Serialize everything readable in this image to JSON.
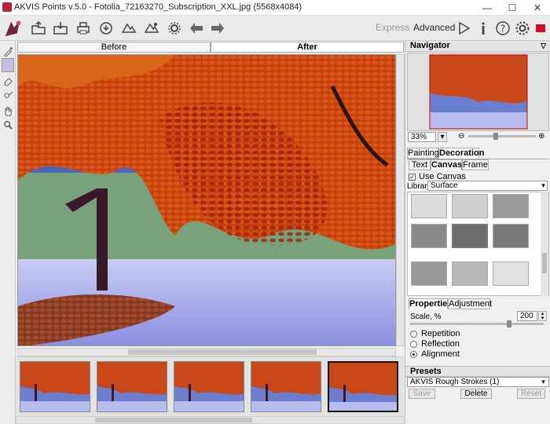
{
  "window": {
    "title": "AKVIS Points v.5.0 - Fotolia_72163270_Subscription_XXL.jpg (5568x4084)",
    "minimize": "—",
    "maximize": "☐",
    "close": "✕"
  },
  "toolbar": {
    "express": "Express",
    "advanced": "Advanced"
  },
  "view_tabs": {
    "before": "Before",
    "after": "After"
  },
  "navigator": {
    "title": "Navigator",
    "zoom": "33%"
  },
  "settings_tabs": {
    "painting": "Painting",
    "decoration": "Decoration"
  },
  "decoration_tabs": {
    "text": "Text",
    "canvas": "Canvas",
    "frame": "Frame"
  },
  "canvas": {
    "use_canvas_label": "Use Canvas",
    "library_label": "Library",
    "library_value": "Surface"
  },
  "properties_tabs": {
    "properties": "Properties",
    "adjustment": "Adjustment"
  },
  "properties": {
    "scale_label": "Scale, %",
    "scale_value": "200",
    "options": [
      "Repetition",
      "Reflection",
      "Alignment"
    ],
    "selected": "Alignment"
  },
  "presets": {
    "title": "Presets",
    "selected": "AKVIS Rough Strokes (1)",
    "save": "Save",
    "delete": "Delete",
    "reset": "Reset"
  },
  "colors": {
    "accent_red": "#cc1020",
    "preset_sel": "#ffffff"
  }
}
